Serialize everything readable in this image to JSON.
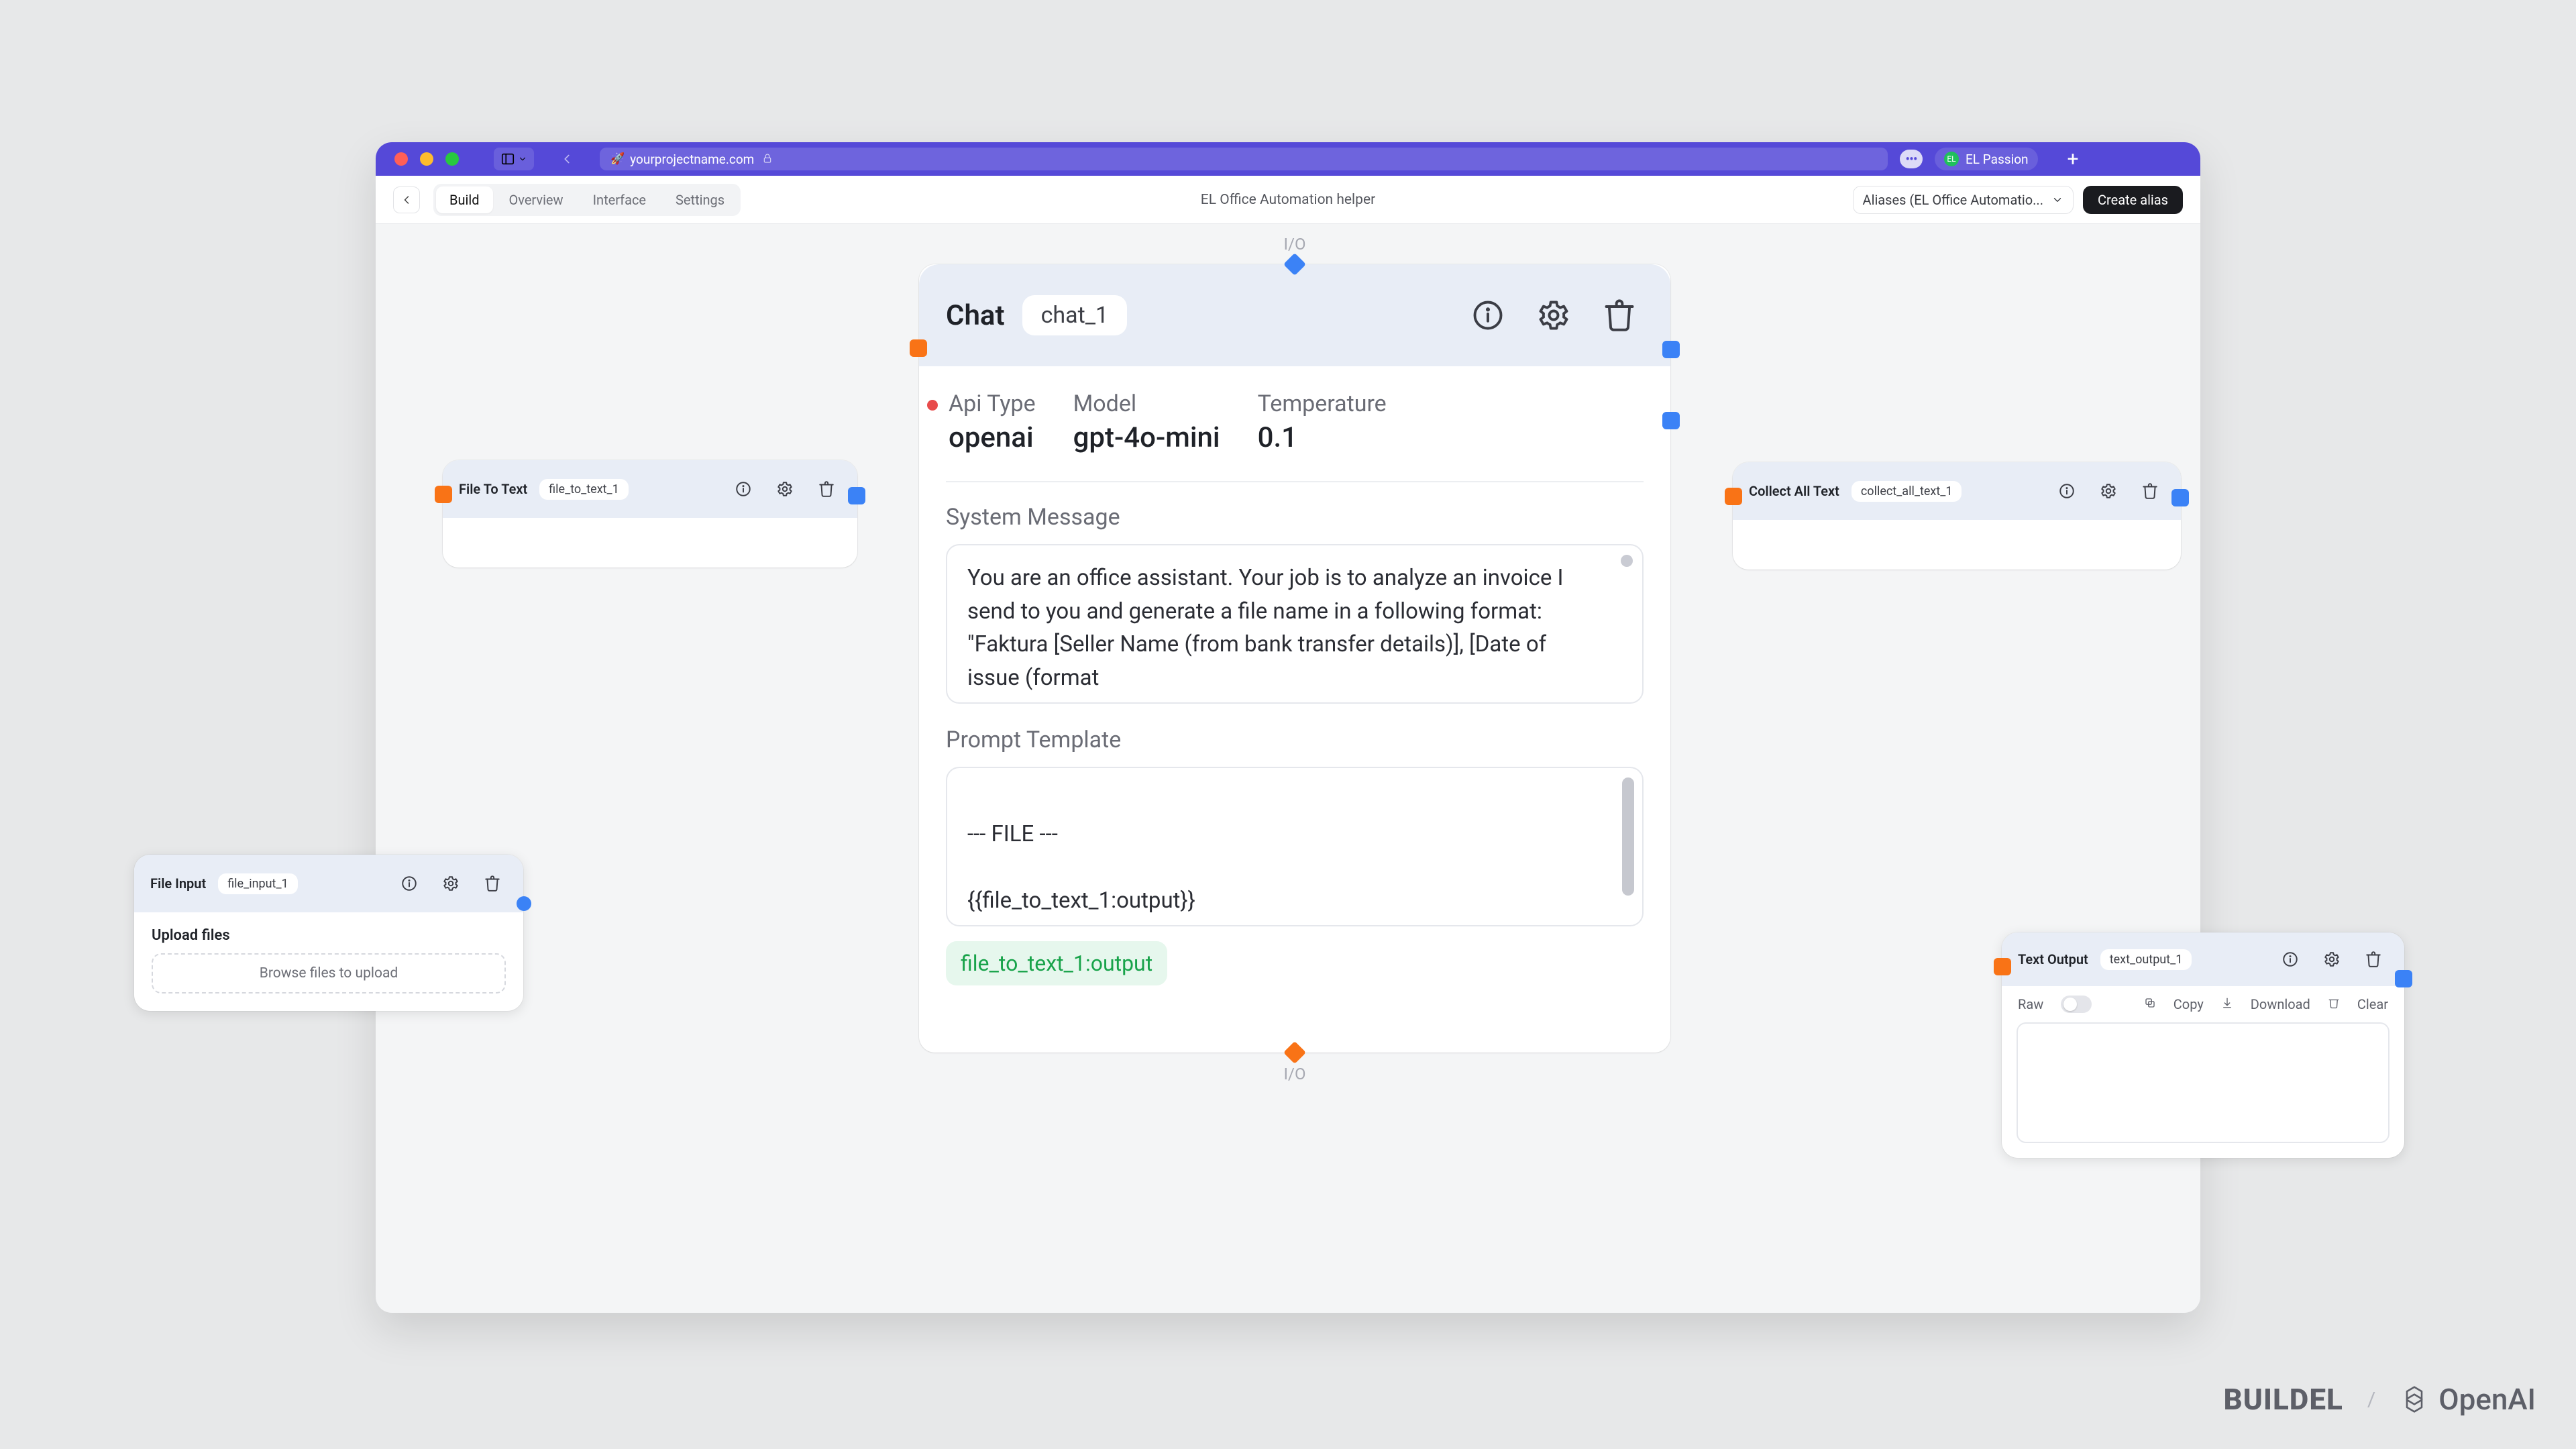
{
  "browser": {
    "url": "yourprojectname.com",
    "user_label": "EL Passion"
  },
  "toolbar": {
    "tabs": {
      "build": "Build",
      "overview": "Overview",
      "interface": "Interface",
      "settings": "Settings"
    },
    "title": "EL Office Automation helper",
    "alias_select": "Aliases (EL Office Automatio...",
    "create_alias": "Create alias"
  },
  "io_label": "I/O",
  "chat": {
    "title": "Chat",
    "id": "chat_1",
    "api_type_label": "Api Type",
    "api_type_value": "openai",
    "model_label": "Model",
    "model_value": "gpt-4o-mini",
    "temperature_label": "Temperature",
    "temperature_value": "0.1",
    "system_message_label": "System Message",
    "system_message_value": "You are an office assistant. Your job is to analyze an invoice I send to you and generate a file name in a following format: \"Faktura [Seller Name (from bank transfer details)], [Date of issue (format",
    "prompt_template_label": "Prompt Template",
    "prompt_template_value": "--- FILE ---\n\n{{file_to_text_1:output}}\n",
    "link_chip": "file_to_text_1:output"
  },
  "file_to_text": {
    "title": "File To Text",
    "id": "file_to_text_1"
  },
  "collect_all_text": {
    "title": "Collect All Text",
    "id": "collect_all_text_1"
  },
  "file_input": {
    "title": "File Input",
    "id": "file_input_1",
    "upload_label": "Upload files",
    "dropzone": "Browse files to upload"
  },
  "text_output": {
    "title": "Text Output",
    "id": "text_output_1",
    "raw": "Raw",
    "copy": "Copy",
    "download": "Download",
    "clear": "Clear"
  },
  "footer": {
    "buildel": "BUILDEL",
    "openai": "OpenAI"
  }
}
